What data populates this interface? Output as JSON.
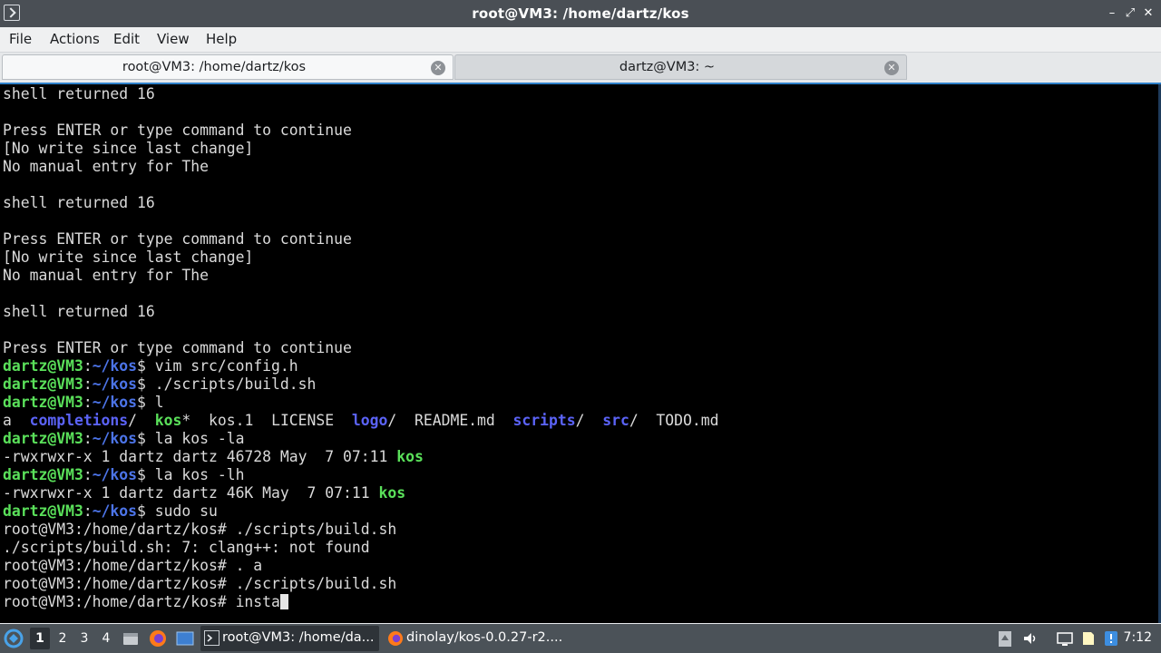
{
  "window": {
    "title": "root@VM3: /home/dartz/kos",
    "controls": {
      "minimize": "–",
      "restore": "⤢",
      "close": "✕"
    }
  },
  "menu": [
    "File",
    "Actions",
    "Edit",
    "View",
    "Help"
  ],
  "tabs": [
    {
      "label": "root@VM3: /home/dartz/kos",
      "active": true
    },
    {
      "label": "dartz@VM3: ~",
      "active": false
    }
  ],
  "terminal": {
    "lines": [
      [
        {
          "t": "shell returned 16"
        }
      ],
      [],
      [
        {
          "t": "Press ENTER or type command to continue"
        }
      ],
      [
        {
          "t": "[No write since last change]"
        }
      ],
      [
        {
          "t": "No manual entry for The"
        }
      ],
      [],
      [
        {
          "t": "shell returned 16"
        }
      ],
      [],
      [
        {
          "t": "Press ENTER or type command to continue"
        }
      ],
      [
        {
          "t": "[No write since last change]"
        }
      ],
      [
        {
          "t": "No manual entry for The"
        }
      ],
      [],
      [
        {
          "t": "shell returned 16"
        }
      ],
      [],
      [
        {
          "t": "Press ENTER or type command to continue"
        }
      ],
      [
        {
          "t": "dartz@VM3",
          "c": "user"
        },
        {
          "t": ":"
        },
        {
          "t": "~/kos",
          "c": "path"
        },
        {
          "t": "$ vim src/config.h"
        }
      ],
      [
        {
          "t": "dartz@VM3",
          "c": "user"
        },
        {
          "t": ":"
        },
        {
          "t": "~/kos",
          "c": "path"
        },
        {
          "t": "$ ./scripts/build.sh"
        }
      ],
      [
        {
          "t": "dartz@VM3",
          "c": "user"
        },
        {
          "t": ":"
        },
        {
          "t": "~/kos",
          "c": "path"
        },
        {
          "t": "$ l"
        }
      ],
      [
        {
          "t": "a  "
        },
        {
          "t": "completions",
          "c": "dir"
        },
        {
          "t": "/  "
        },
        {
          "t": "kos",
          "c": "exe"
        },
        {
          "t": "*  kos.1  LICENSE  "
        },
        {
          "t": "logo",
          "c": "dir"
        },
        {
          "t": "/  README.md  "
        },
        {
          "t": "scripts",
          "c": "dir"
        },
        {
          "t": "/  "
        },
        {
          "t": "src",
          "c": "dir"
        },
        {
          "t": "/  TODO.md"
        }
      ],
      [
        {
          "t": "dartz@VM3",
          "c": "user"
        },
        {
          "t": ":"
        },
        {
          "t": "~/kos",
          "c": "path"
        },
        {
          "t": "$ la kos -la"
        }
      ],
      [
        {
          "t": "-rwxrwxr-x 1 dartz dartz 46728 May  7 07:11 "
        },
        {
          "t": "kos",
          "c": "exe"
        }
      ],
      [
        {
          "t": "dartz@VM3",
          "c": "user"
        },
        {
          "t": ":"
        },
        {
          "t": "~/kos",
          "c": "path"
        },
        {
          "t": "$ la kos -lh"
        }
      ],
      [
        {
          "t": "-rwxrwxr-x 1 dartz dartz 46K May  7 07:11 "
        },
        {
          "t": "kos",
          "c": "exe"
        }
      ],
      [
        {
          "t": "dartz@VM3",
          "c": "user"
        },
        {
          "t": ":"
        },
        {
          "t": "~/kos",
          "c": "path"
        },
        {
          "t": "$ sudo su"
        }
      ],
      [
        {
          "t": "root@VM3:/home/dartz/kos# ./scripts/build.sh"
        }
      ],
      [
        {
          "t": "./scripts/build.sh: 7: clang++: not found"
        }
      ],
      [
        {
          "t": "root@VM3:/home/dartz/kos# . a"
        }
      ],
      [
        {
          "t": "root@VM3:/home/dartz/kos# ./scripts/build.sh"
        }
      ],
      [
        {
          "t": "root@VM3:/home/dartz/kos# insta"
        },
        {
          "cursor": true
        }
      ]
    ]
  },
  "taskbar": {
    "workspaces": [
      "1",
      "2",
      "3",
      "4"
    ],
    "active_workspace": "1",
    "tasks": [
      {
        "label": "root@VM3: /home/da...",
        "icon": "terminal-icon",
        "active": true
      },
      {
        "label": "dinolay/kos-0.0.27-r2....",
        "icon": "firefox-icon",
        "active": false
      }
    ],
    "clock": "7:12",
    "colors": {
      "panel": "#4b5258",
      "accent": "#2f80c9"
    }
  }
}
